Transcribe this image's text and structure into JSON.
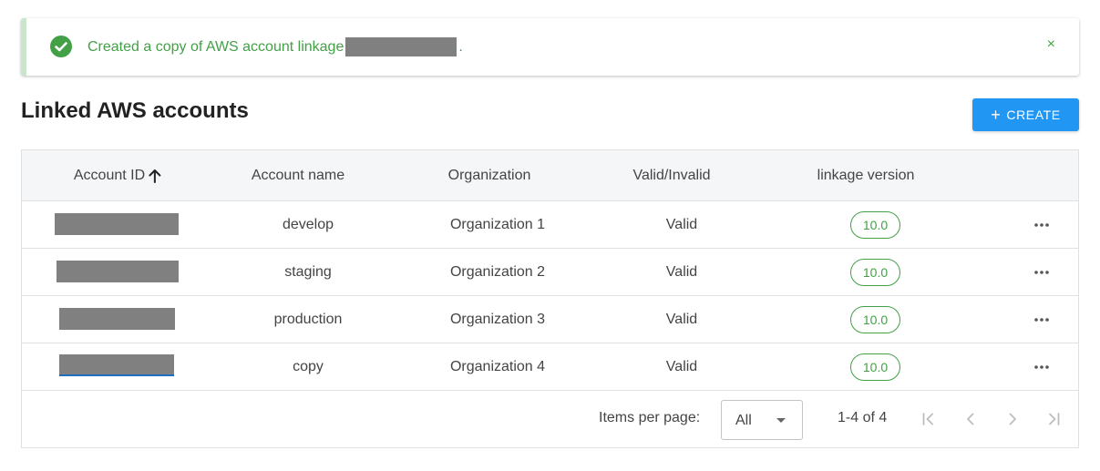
{
  "alert": {
    "message_prefix": "Created a copy of AWS account linkage",
    "message_suffix": ".",
    "close_label": "×"
  },
  "header": {
    "title": "Linked AWS accounts",
    "create_label": "CREATE"
  },
  "table": {
    "columns": {
      "account_id": "Account ID",
      "account_name": "Account name",
      "organization": "Organization",
      "valid": "Valid/Invalid",
      "version": "linkage version"
    },
    "rows": [
      {
        "account_name": "develop",
        "organization": "Organization 1",
        "valid": "Valid",
        "version": "10.0"
      },
      {
        "account_name": "staging",
        "organization": "Organization 2",
        "valid": "Valid",
        "version": "10.0"
      },
      {
        "account_name": "production",
        "organization": "Organization 3",
        "valid": "Valid",
        "version": "10.0"
      },
      {
        "account_name": "copy",
        "organization": "Organization 4",
        "valid": "Valid",
        "version": "10.0"
      }
    ]
  },
  "pagination": {
    "items_per_page_label": "Items per page:",
    "items_per_page_value": "All",
    "range": "1-4 of 4"
  },
  "colors": {
    "success": "#43a047",
    "primary": "#2196f3"
  }
}
